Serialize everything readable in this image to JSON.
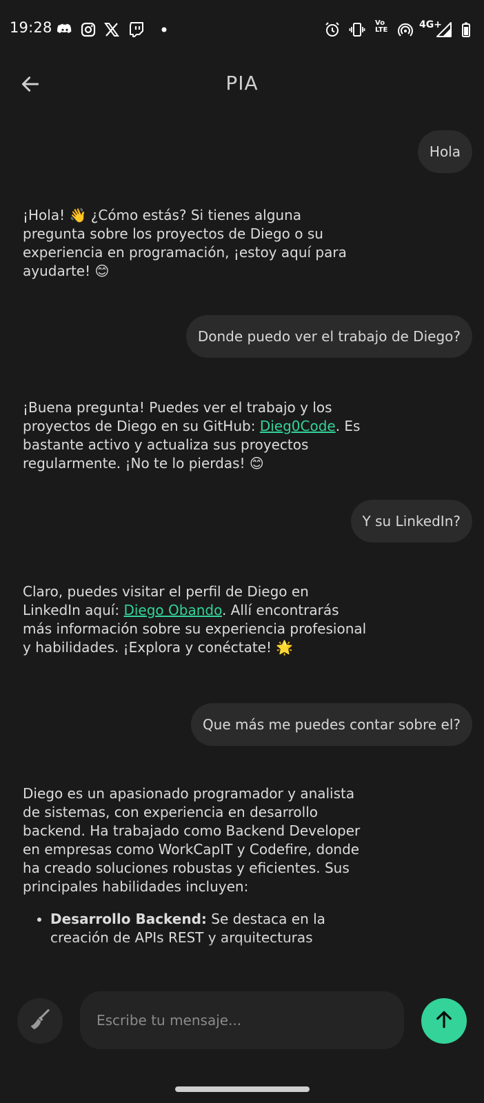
{
  "status_bar": {
    "time": "19:28",
    "network": "4G+",
    "volte_line1": "Vo",
    "volte_line2": "LTE",
    "notification_icons": [
      "discord-icon",
      "instagram-icon",
      "x-icon",
      "twitch-icon",
      "dot-icon"
    ],
    "system_icons": [
      "alarm-icon",
      "vibrate-icon",
      "volte-icon",
      "hotspot-icon",
      "signal-icon",
      "battery-icon"
    ]
  },
  "header": {
    "title": "PIA",
    "back_icon": "arrow-left-icon"
  },
  "chat": {
    "m1_user": "Hola",
    "m2_bot": "¡Hola! 👋 ¿Cómo estás? Si tienes alguna pregunta sobre los proyectos de Diego o su experiencia en programación, ¡estoy aquí para ayudarte! 😊",
    "m3_user": "Donde puedo ver el trabajo de Diego?",
    "m4_bot": {
      "before": "¡Buena pregunta! Puedes ver el trabajo y los proyectos de Diego en su GitHub: ",
      "link": "Dieg0Code",
      "after": ". Es bastante activo y actualiza sus proyectos regularmente. ¡No te lo pierdas! 😊"
    },
    "m5_user": "Y su LinkedIn?",
    "m6_bot": {
      "before": "Claro, puedes visitar el perfil de Diego en LinkedIn aquí: ",
      "link": "Diego Obando",
      "after": ". Allí encontrarás más información sobre su experiencia profesional y habilidades. ¡Explora y conéctate! 🌟"
    },
    "m7_user": "Que más me puedes contar sobre el?",
    "m8_bot": {
      "paragraph": "Diego es un apasionado programador y analista de sistemas, con experiencia en desarrollo backend. Ha trabajado como Backend Developer en empresas como WorkCapIT y Codefire, donde ha creado soluciones robustas y eficientes. Sus principales habilidades incluyen:",
      "bullet_title": "Desarrollo Backend:",
      "bullet_text": " Se destaca en la creación de APIs REST y arquitecturas"
    }
  },
  "input": {
    "placeholder": "Escribe tu mensaje...",
    "value": "",
    "clear_icon": "broom-icon",
    "send_icon": "arrow-up-icon"
  },
  "colors": {
    "background": "#1a1a1a",
    "bubble": "#2b2b2b",
    "accent": "#34d399",
    "text": "#dcdcdc"
  }
}
